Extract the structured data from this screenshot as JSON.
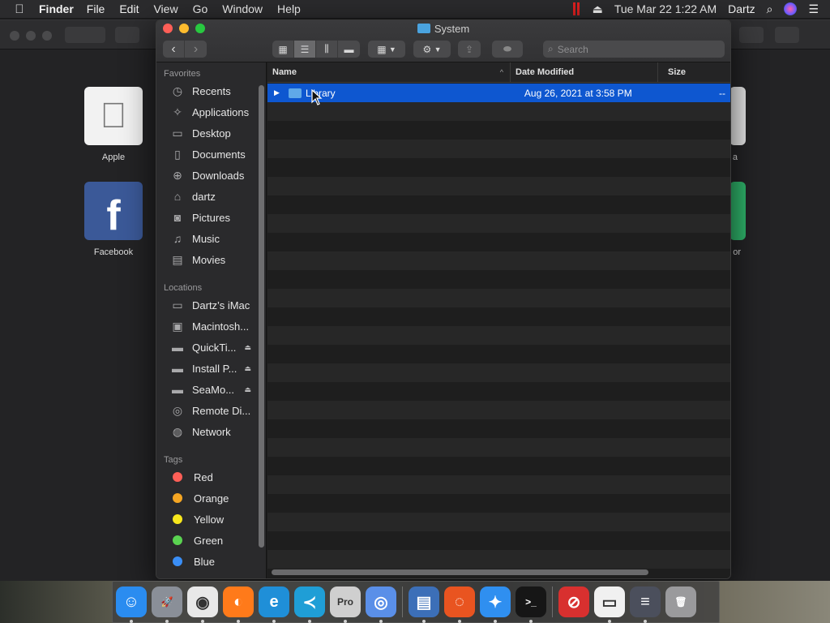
{
  "menubar": {
    "app_name": "Finder",
    "menus": [
      "File",
      "Edit",
      "View",
      "Go",
      "Window",
      "Help"
    ],
    "datetime": "Tue Mar 22  1:22 AM",
    "user": "Dartz"
  },
  "background_app": {
    "tiles": [
      {
        "label": "Apple",
        "color": "#f2f2f2"
      },
      {
        "label": "Facebook",
        "color": "#3b5998"
      }
    ],
    "partial_labels": [
      "a",
      "or"
    ]
  },
  "finder": {
    "title": "System",
    "search_placeholder": "Search",
    "sidebar": {
      "favorites_header": "Favorites",
      "favorites": [
        {
          "label": "Recents",
          "icon": "clock-icon"
        },
        {
          "label": "Applications",
          "icon": "applications-icon"
        },
        {
          "label": "Desktop",
          "icon": "desktop-icon"
        },
        {
          "label": "Documents",
          "icon": "document-icon"
        },
        {
          "label": "Downloads",
          "icon": "download-icon"
        },
        {
          "label": "dartz",
          "icon": "home-icon"
        },
        {
          "label": "Pictures",
          "icon": "camera-icon"
        },
        {
          "label": "Music",
          "icon": "music-note-icon"
        },
        {
          "label": "Movies",
          "icon": "film-icon"
        }
      ],
      "locations_header": "Locations",
      "locations": [
        {
          "label": "Dartz’s iMac",
          "icon": "imac-icon"
        },
        {
          "label": "Macintosh...",
          "icon": "hard-drive-icon"
        },
        {
          "label": "QuickTi...",
          "icon": "drive-icon",
          "eject": true
        },
        {
          "label": "Install P...",
          "icon": "drive-icon",
          "eject": true
        },
        {
          "label": "SeaMo...",
          "icon": "drive-icon",
          "eject": true
        },
        {
          "label": "Remote Di...",
          "icon": "disc-icon"
        },
        {
          "label": "Network",
          "icon": "globe-icon"
        }
      ],
      "tags_header": "Tags",
      "tags": [
        {
          "label": "Red",
          "color": "#fe5f57"
        },
        {
          "label": "Orange",
          "color": "#f5a623"
        },
        {
          "label": "Yellow",
          "color": "#f8e71c"
        },
        {
          "label": "Green",
          "color": "#5ad351"
        },
        {
          "label": "Blue",
          "color": "#3a8ef6"
        }
      ]
    },
    "columns": {
      "name": "Name",
      "date_modified": "Date Modified",
      "size": "Size"
    },
    "rows": [
      {
        "name": "Library",
        "date_modified": "Aug 26, 2021 at 3:58 PM",
        "size": "--",
        "selected": true
      }
    ]
  },
  "dock": {
    "apps": [
      {
        "name": "finder-icon",
        "color": "#2a8cf0",
        "glyph": "☺"
      },
      {
        "name": "launchpad-icon",
        "color": "#8a8f98",
        "glyph": "🚀"
      },
      {
        "name": "chrome-icon",
        "color": "#e8e8e8",
        "glyph": "◉"
      },
      {
        "name": "firefox-icon",
        "color": "#ff7a1a",
        "glyph": "◐"
      },
      {
        "name": "edge-icon",
        "color": "#1f8fd8",
        "glyph": "e"
      },
      {
        "name": "vscode-icon",
        "color": "#1f9ed6",
        "glyph": "≺"
      },
      {
        "name": "google-earth-pro-icon",
        "color": "#cfcfcf",
        "glyph": "Pro"
      },
      {
        "name": "chromium-icon",
        "color": "#5a8fe8",
        "glyph": "◎"
      },
      {
        "name": "parallels-windows-icon",
        "color": "#3c6fb8",
        "glyph": "▤"
      },
      {
        "name": "ubuntu-icon",
        "color": "#e95420",
        "glyph": "◌"
      },
      {
        "name": "safari-icon",
        "color": "#2f8ff0",
        "glyph": "✦"
      },
      {
        "name": "terminal-icon",
        "color": "#161616",
        "glyph": ">_"
      },
      {
        "name": "no-entry-app-icon",
        "color": "#d8302f",
        "glyph": "⊘"
      },
      {
        "name": "preview-icon",
        "color": "#f0f0f0",
        "glyph": "▭"
      },
      {
        "name": "settings-app-icon",
        "color": "#4b4f5c",
        "glyph": "≡"
      },
      {
        "name": "trash-icon",
        "color": "#9a9a9c",
        "glyph": "🗑"
      }
    ]
  }
}
